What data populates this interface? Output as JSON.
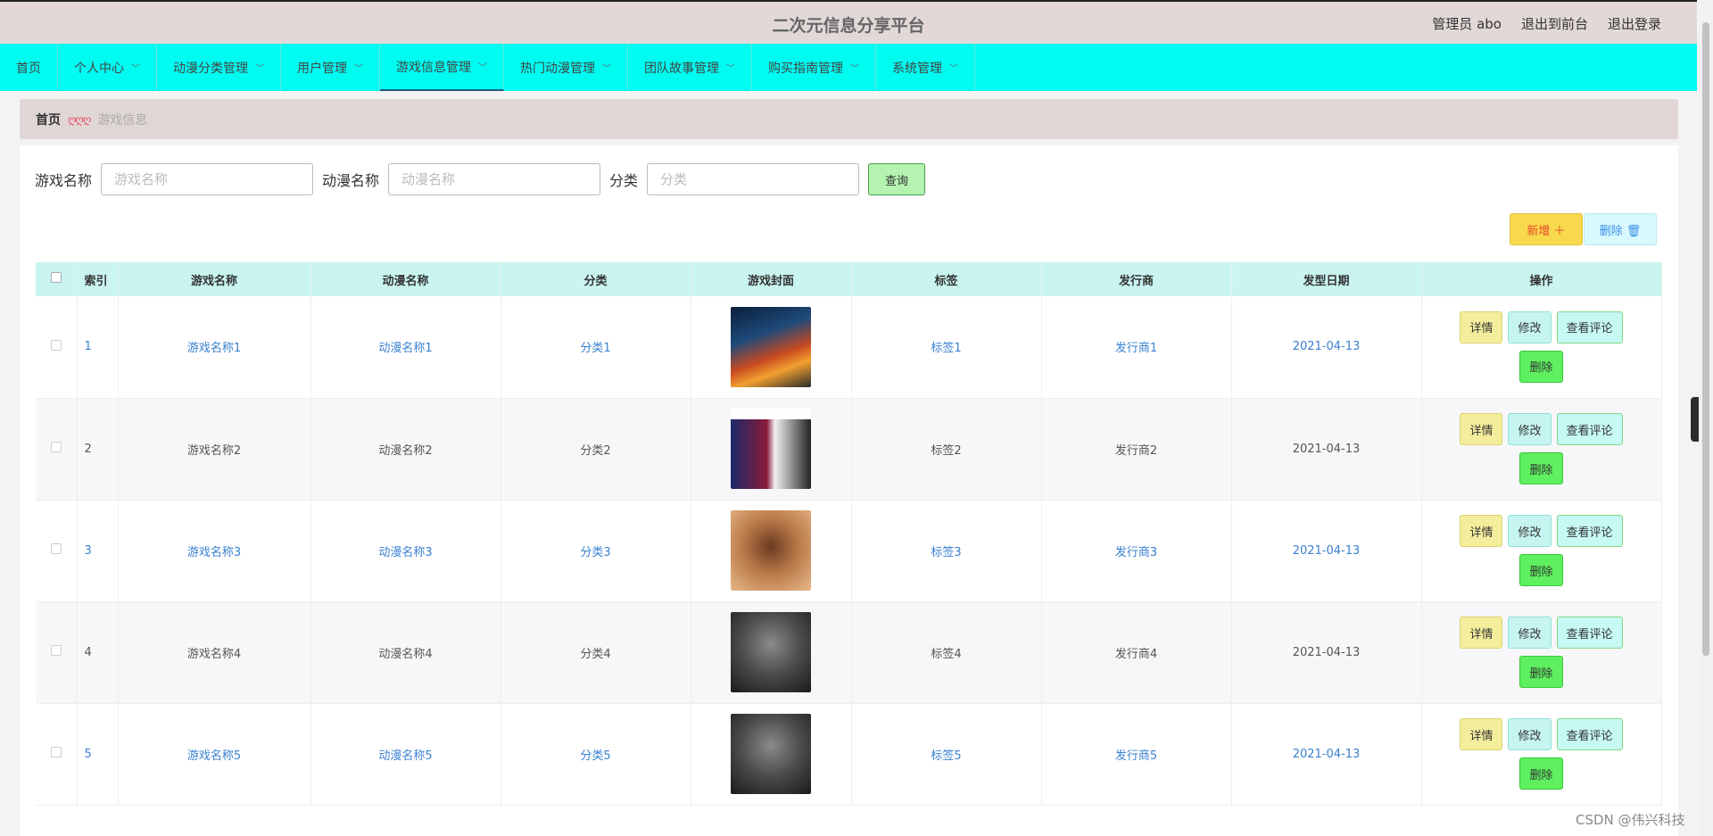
{
  "header": {
    "title": "二次元信息分享平台",
    "admin": "管理员 abo",
    "front": "退出到前台",
    "logout": "退出登录"
  },
  "nav": [
    {
      "label": "首页",
      "caret": false
    },
    {
      "label": "个人中心",
      "caret": true
    },
    {
      "label": "动漫分类管理",
      "caret": true
    },
    {
      "label": "用户管理",
      "caret": true
    },
    {
      "label": "游戏信息管理",
      "caret": true,
      "active": true
    },
    {
      "label": "热门动漫管理",
      "caret": true
    },
    {
      "label": "团队故事管理",
      "caret": true
    },
    {
      "label": "购买指南管理",
      "caret": true
    },
    {
      "label": "系统管理",
      "caret": true
    }
  ],
  "breadcrumb": {
    "home": "首页",
    "current": "游戏信息"
  },
  "search": {
    "game_label": "游戏名称",
    "game_placeholder": "游戏名称",
    "anime_label": "动漫名称",
    "anime_placeholder": "动漫名称",
    "category_label": "分类",
    "category_placeholder": "分类",
    "query_button": "查询"
  },
  "actions": {
    "add": "新增 ＋",
    "delete": "删除 🗑"
  },
  "table": {
    "headers": [
      "索引",
      "游戏名称",
      "动漫名称",
      "分类",
      "游戏封面",
      "标签",
      "发行商",
      "发型日期",
      "操作"
    ],
    "rows": [
      {
        "idx": "1",
        "game": "游戏名称1",
        "anime": "动漫名称1",
        "category": "分类1",
        "tag": "标签1",
        "publisher": "发行商1",
        "date": "2021-04-13",
        "cover": "racing-car-icon"
      },
      {
        "idx": "2",
        "game": "游戏名称2",
        "anime": "动漫名称2",
        "category": "分类2",
        "tag": "标签2",
        "publisher": "发行商2",
        "date": "2021-04-13",
        "cover": "football-players-icon"
      },
      {
        "idx": "3",
        "game": "游戏名称3",
        "anime": "动漫名称3",
        "category": "分类3",
        "tag": "标签3",
        "publisher": "发行商3",
        "date": "2021-04-13",
        "cover": "warrior-art-icon"
      },
      {
        "idx": "4",
        "game": "游戏名称4",
        "anime": "动漫名称4",
        "category": "分类4",
        "tag": "标签4",
        "publisher": "发行商4",
        "date": "2021-04-13",
        "cover": "soldiers-icon"
      },
      {
        "idx": "5",
        "game": "游戏名称5",
        "anime": "动漫名称5",
        "category": "分类5",
        "tag": "标签5",
        "publisher": "发行商5",
        "date": "2021-04-13",
        "cover": "soldiers-icon"
      }
    ],
    "ops": {
      "detail": "详情",
      "edit": "修改",
      "comment": "查看评论",
      "delete": "删除"
    }
  },
  "watermark": "CSDN @伟兴科技"
}
